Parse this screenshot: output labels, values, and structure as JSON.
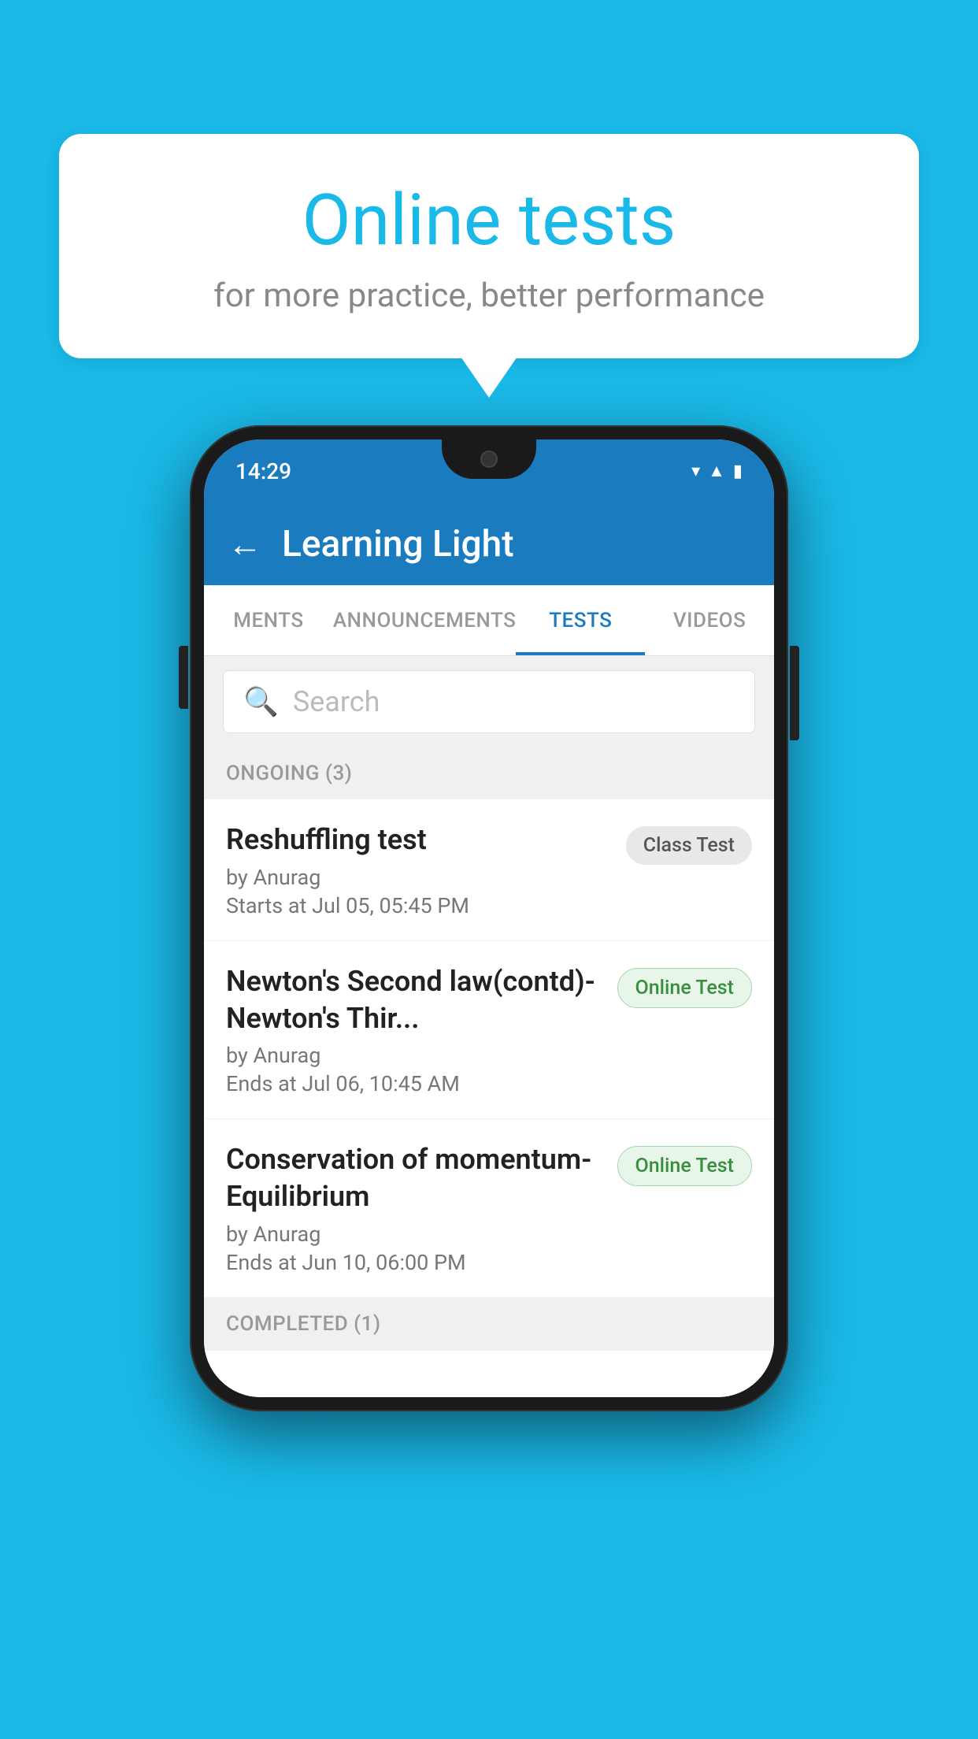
{
  "background_color": "#1ab9e8",
  "bubble": {
    "title": "Online tests",
    "subtitle": "for more practice, better performance"
  },
  "phone": {
    "status_bar": {
      "time": "14:29",
      "wifi_icon": "▾",
      "signal_icon": "▲",
      "battery_icon": "▮"
    },
    "app_bar": {
      "back_label": "←",
      "title": "Learning Light"
    },
    "tabs": [
      {
        "label": "MENTS",
        "active": false
      },
      {
        "label": "ANNOUNCEMENTS",
        "active": false
      },
      {
        "label": "TESTS",
        "active": true
      },
      {
        "label": "VIDEOS",
        "active": false
      }
    ],
    "search": {
      "placeholder": "Search",
      "icon": "🔍"
    },
    "ongoing_section": {
      "label": "ONGOING (3)"
    },
    "tests": [
      {
        "name": "Reshuffling test",
        "author": "by Anurag",
        "date_label": "Starts at",
        "date": "Jul 05, 05:45 PM",
        "badge_text": "Class Test",
        "badge_type": "class"
      },
      {
        "name": "Newton's Second law(contd)-Newton's Thir...",
        "author": "by Anurag",
        "date_label": "Ends at",
        "date": "Jul 06, 10:45 AM",
        "badge_text": "Online Test",
        "badge_type": "online"
      },
      {
        "name": "Conservation of momentum-Equilibrium",
        "author": "by Anurag",
        "date_label": "Ends at",
        "date": "Jun 10, 06:00 PM",
        "badge_text": "Online Test",
        "badge_type": "online"
      }
    ],
    "completed_section": {
      "label": "COMPLETED (1)"
    }
  }
}
